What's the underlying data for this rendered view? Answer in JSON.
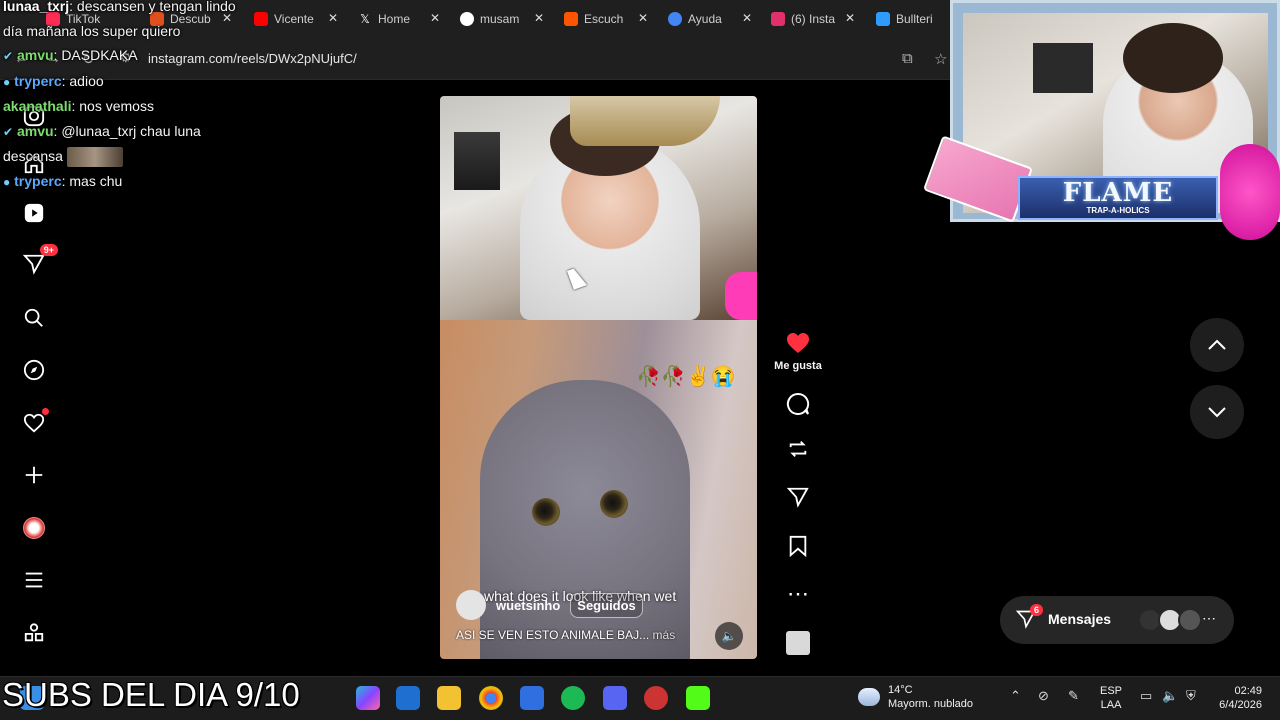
{
  "browser": {
    "tabs": [
      {
        "label": "TikTok",
        "color": "#ff2c55"
      },
      {
        "label": "Descub",
        "color": "#e0501f"
      },
      {
        "label": "Vicente",
        "color": "#ff0000"
      },
      {
        "label": "Home",
        "color": "#ffffff"
      },
      {
        "label": "musam",
        "color": "#4285f4"
      },
      {
        "label": "Escuch",
        "color": "#ff5500"
      },
      {
        "label": "Ayuda",
        "color": "#4285f4"
      },
      {
        "label": "(6) Insta",
        "color": "#e1306c"
      },
      {
        "label": "Bullteri",
        "color": "#2e9bff"
      }
    ],
    "url": "instagram.com/reels/DWx2pNUjufC/"
  },
  "chat": [
    {
      "user": "lunaa_txrj",
      "text": "descansen y tengan lindo",
      "user_color": "white"
    },
    {
      "user": "",
      "text": "día mañana los super quiero",
      "user_color": "white"
    },
    {
      "user": "amvu",
      "text": "DASDKAKA",
      "user_color": "green"
    },
    {
      "user": "tryperc",
      "text": "adioo",
      "user_color": "blue"
    },
    {
      "user": "akanathali",
      "text": "nos vemoss",
      "user_color": "green"
    },
    {
      "user": "amvu",
      "text": "@lunaa_txrj chau luna",
      "user_color": "green"
    },
    {
      "user": "",
      "text": "descansa",
      "user_color": "white"
    },
    {
      "user": "tryperc",
      "text": "mas chu",
      "user_color": "blue"
    }
  ],
  "sidebar": {
    "notification_badge": "9+",
    "items": [
      "instagram-logo",
      "home",
      "reels",
      "direct",
      "search",
      "explore",
      "notifications",
      "create",
      "profile",
      "more",
      "also-from-meta"
    ]
  },
  "reel": {
    "author": "wuetsinho",
    "follow_label": "Seguidos",
    "overlay_text": "what does it look like when wet",
    "description": "ASI SE VEN ESTO ANIMALE BAJ...",
    "more_label": "más",
    "emojis": "🥀🥀✌😭",
    "like_label": "Me gusta"
  },
  "messages": {
    "label": "Mensajes",
    "badge": "6"
  },
  "webcam": {
    "banner": "FLAME",
    "banner_sub": "TRAP-A-HOLICS"
  },
  "overlay": {
    "subs": "SUBS DEL DIA 9/10"
  },
  "taskbar": {
    "weather_temp": "14°C",
    "weather_desc": "Mayorm. nublado",
    "lang_top": "ESP",
    "lang_bottom": "LAA",
    "time": "02:49",
    "date": "6/4/2026"
  }
}
